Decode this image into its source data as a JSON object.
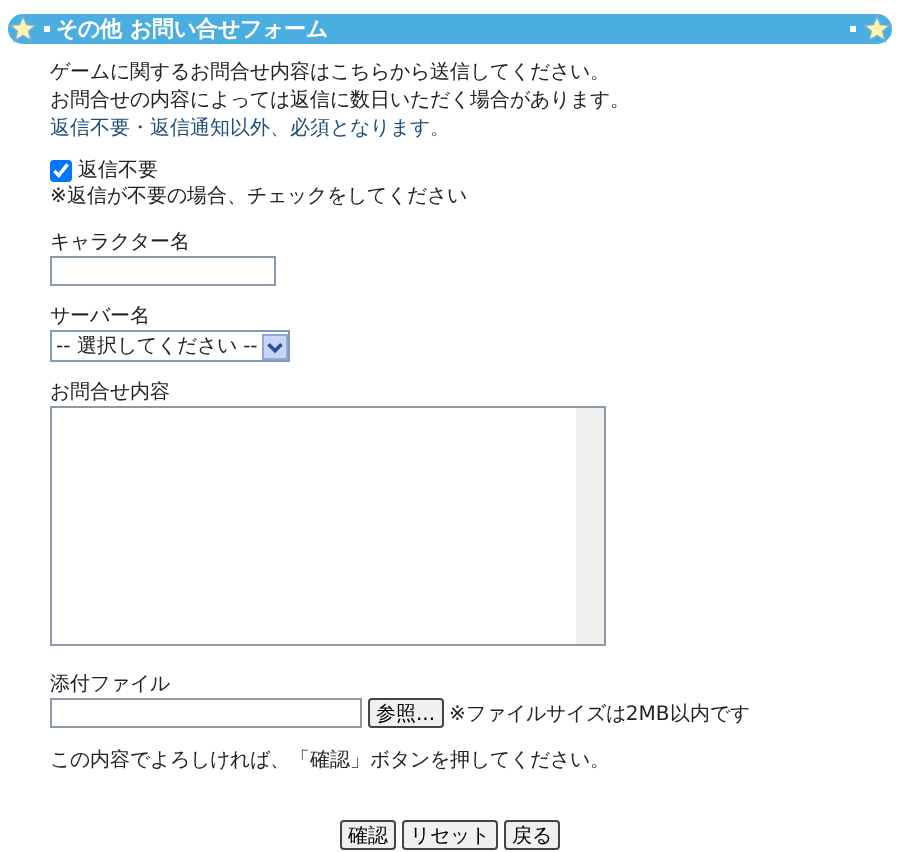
{
  "header": {
    "title": "その他 お問い合せフォーム"
  },
  "intro": [
    "ゲームに関するお問合せ内容はこちらから送信してください。",
    "お問合せの内容によっては返信に数日いただく場合があります。"
  ],
  "required_note": "返信不要・返信通知以外、必須となります。",
  "no_reply": {
    "label": "返信不要",
    "checked": true,
    "note": "※返信が不要の場合、チェックをしてください"
  },
  "character_name": {
    "label": "キャラクター名"
  },
  "server": {
    "label": "サーバー名",
    "value": "-- 選択してください --"
  },
  "inquiry": {
    "label": "お問合せ内容"
  },
  "attachment": {
    "label": "添付ファイル",
    "browse": "参照...",
    "note": "※ファイルサイズは2MB以内です"
  },
  "confirm_note": "この内容でよろしければ、「確認」ボタンを押してください。",
  "buttons": [
    "確認",
    "リセット",
    "戻る"
  ]
}
